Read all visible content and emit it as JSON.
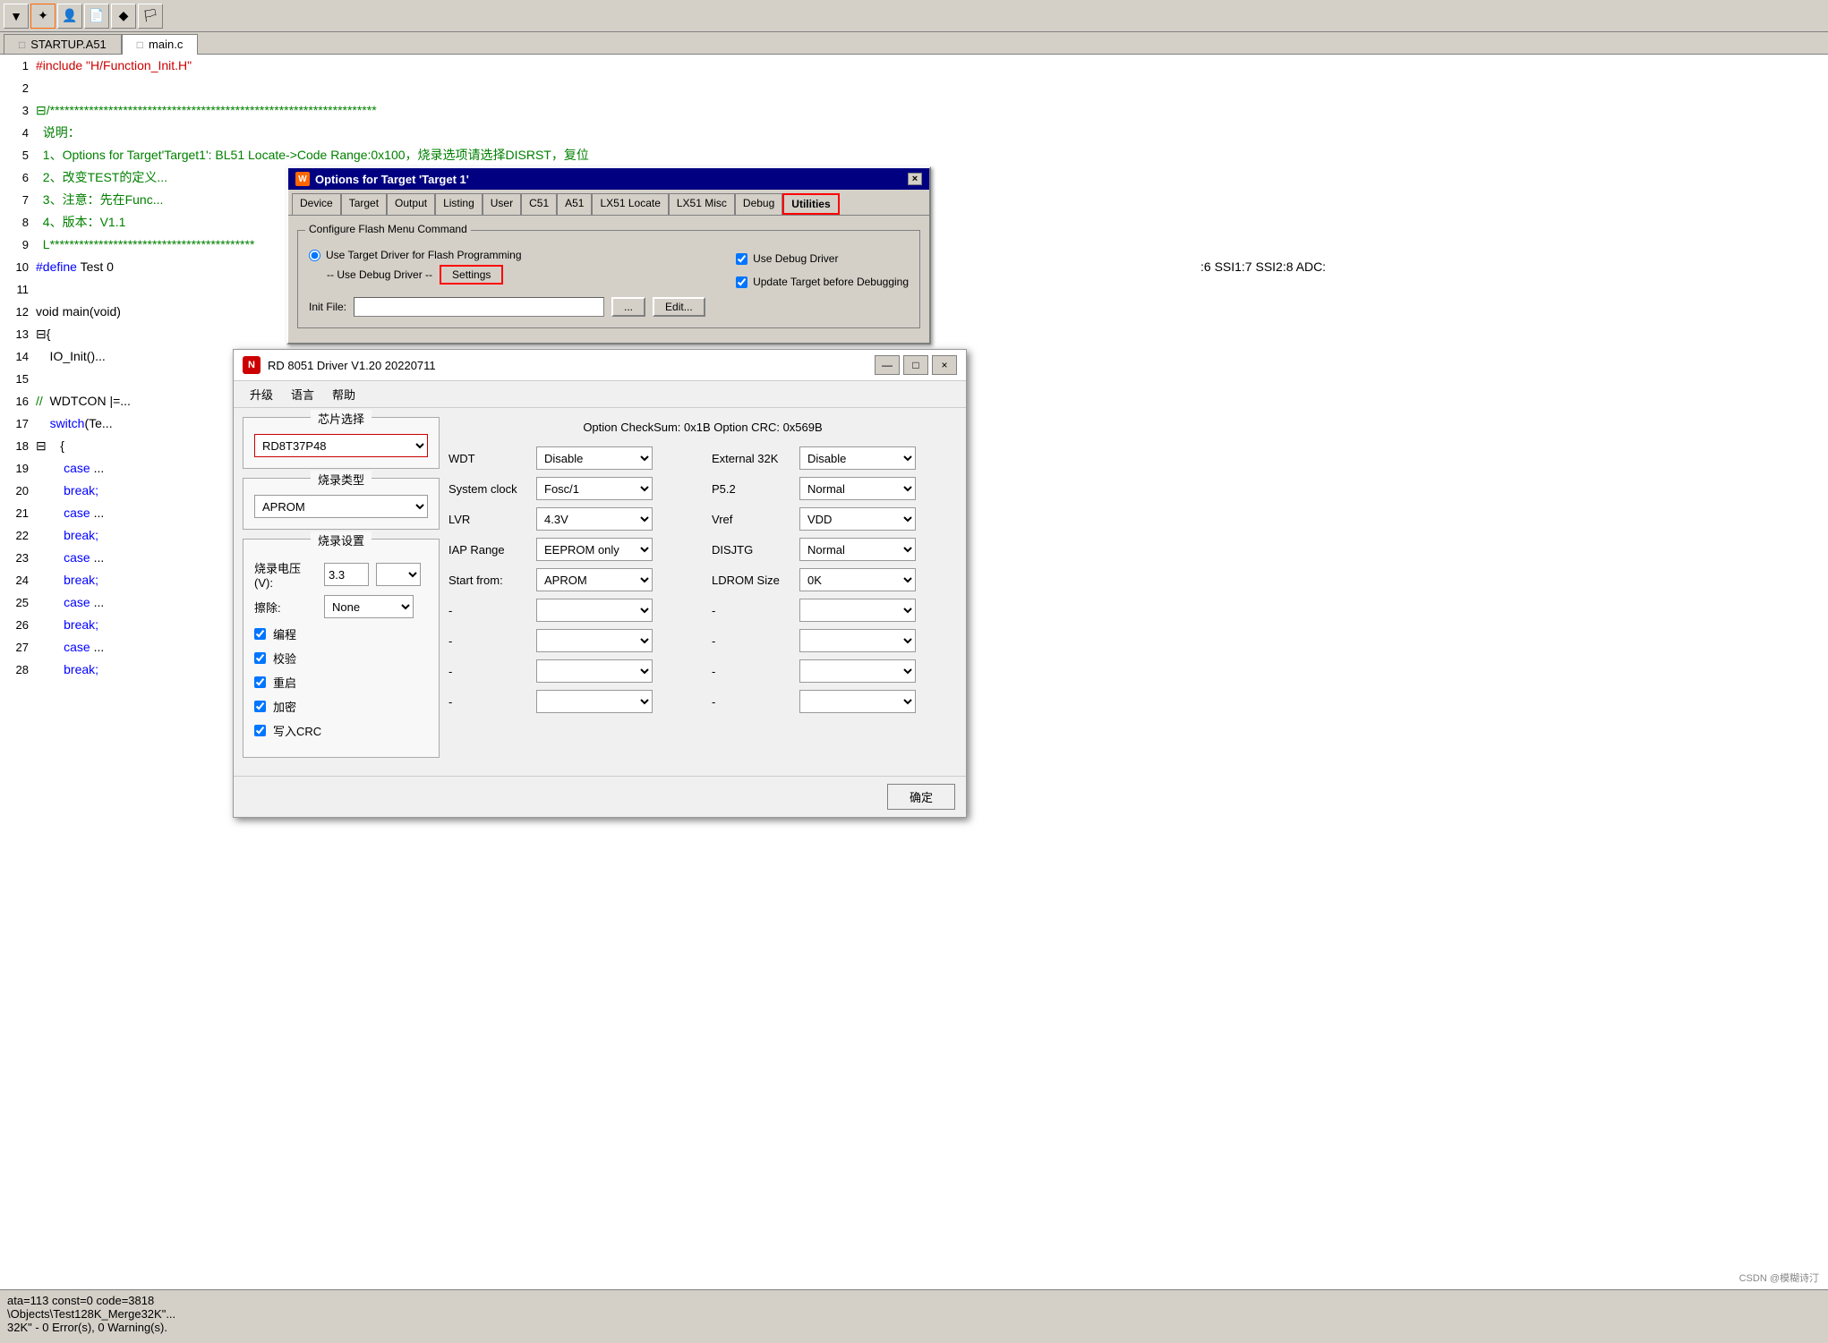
{
  "editor": {
    "toolbar_buttons": [
      "▼",
      "⚙",
      "👤",
      "📄",
      "◆",
      "🏳"
    ],
    "tabs": [
      {
        "label": "STARTUP.A51",
        "icon": "📄",
        "active": false
      },
      {
        "label": "main.c",
        "icon": "📄",
        "active": true
      }
    ],
    "lines": [
      {
        "num": "1",
        "content": "#include \"H/Function_Init.H\"",
        "class": "kw-red"
      },
      {
        "num": "2",
        "content": "",
        "class": "text-black"
      },
      {
        "num": "3",
        "content": "/*******************************************************************",
        "class": "comment-green",
        "prefix": "⊟"
      },
      {
        "num": "4",
        "content": "说明：",
        "class": "comment-green"
      },
      {
        "num": "5",
        "content": "1、Options for Target'Target1': BL51 Locate->Code Range:0x100，烧录选项请选择DISRST，复位",
        "class": "comment-green"
      },
      {
        "num": "6",
        "content": "2、改变TEST的定义...",
        "class": "comment-green"
      },
      {
        "num": "7",
        "content": "3、注意：先在Func...",
        "class": "comment-green"
      },
      {
        "num": "8",
        "content": "4、版本：V1.1",
        "class": "comment-green"
      },
      {
        "num": "9",
        "content": "L******************************************",
        "class": "comment-green",
        "prefix": "⊟"
      },
      {
        "num": "10",
        "content": "#define Test 0",
        "class": "kw-blue",
        "extra": ":6 SSI1:7 SSI2:8 ADC:"
      },
      {
        "num": "11",
        "content": "",
        "class": "text-black"
      },
      {
        "num": "12",
        "content": "void main(void)",
        "class": "text-black"
      },
      {
        "num": "13",
        "content": "{",
        "class": "text-black",
        "prefix": "⊟"
      },
      {
        "num": "14",
        "content": "    IO_Init()...",
        "class": "text-black"
      },
      {
        "num": "15",
        "content": "",
        "class": "text-black"
      },
      {
        "num": "16",
        "content": "// WDTCON |=...",
        "class": "text-black"
      },
      {
        "num": "17",
        "content": "    switch(Te...",
        "class": "kw-blue"
      },
      {
        "num": "18",
        "content": "    {",
        "class": "text-black",
        "prefix": "⊟"
      },
      {
        "num": "19",
        "content": "        case ...",
        "class": "kw-blue"
      },
      {
        "num": "20",
        "content": "        break;",
        "class": "kw-blue"
      },
      {
        "num": "21",
        "content": "        case ...",
        "class": "kw-blue"
      },
      {
        "num": "22",
        "content": "        break;",
        "class": "kw-blue"
      },
      {
        "num": "23",
        "content": "        case ...",
        "class": "kw-blue"
      },
      {
        "num": "24",
        "content": "        break;",
        "class": "kw-blue"
      },
      {
        "num": "25",
        "content": "        case ...",
        "class": "kw-blue"
      },
      {
        "num": "26",
        "content": "        break;",
        "class": "kw-blue"
      },
      {
        "num": "27",
        "content": "        case ...",
        "class": "kw-blue"
      },
      {
        "num": "28",
        "content": "        break;",
        "class": "kw-blue"
      }
    ]
  },
  "status_bar": {
    "line1": "ata=113 const=0 code=3818",
    "line2": "\\Objects\\Test128K_Merge32K\"...",
    "line3": "32K\" - 0 Error(s), 0 Warning(s)."
  },
  "options_dialog": {
    "title": "Options for Target 'Target 1'",
    "tabs": [
      {
        "label": "Device",
        "active": false
      },
      {
        "label": "Target",
        "active": false
      },
      {
        "label": "Output",
        "active": false
      },
      {
        "label": "Listing",
        "active": false
      },
      {
        "label": "User",
        "active": false
      },
      {
        "label": "C51",
        "active": false
      },
      {
        "label": "A51",
        "active": false
      },
      {
        "label": "LX51 Locate",
        "active": false
      },
      {
        "label": "LX51 Misc",
        "active": false
      },
      {
        "label": "Debug",
        "active": false
      },
      {
        "label": "Utilities",
        "active": true
      }
    ],
    "group_title": "Configure Flash Menu Command",
    "radio1": "Use Target Driver for Flash Programming",
    "radio1_checked": true,
    "checkbox1": "Use Debug Driver",
    "checkbox1_checked": true,
    "debug_driver_text": "-- Use Debug Driver --",
    "settings_btn": "Settings",
    "checkbox2": "Update Target before Debugging",
    "checkbox2_checked": true,
    "init_file_label": "Init File:",
    "init_file_value": "",
    "browse_btn": "...",
    "edit_btn": "Edit..."
  },
  "rd_dialog": {
    "title": "RD 8051 Driver V1.20 20220711",
    "logo": "N",
    "menu": [
      "升级",
      "语言",
      "帮助"
    ],
    "minimize": "—",
    "restore": "□",
    "close": "×",
    "chip_section": "芯片选择",
    "chip_value": "RD8T37P48",
    "burn_type_section": "烧录类型",
    "burn_type_value": "APROM",
    "burn_settings_section": "烧录设置",
    "voltage_label": "烧录电压(V):",
    "voltage_value": "3.3",
    "erase_label": "擦除:",
    "erase_value": "None",
    "cb_program": "编程",
    "cb_verify": "校验",
    "cb_reset": "重启",
    "cb_encrypt": "加密",
    "cb_write_crc": "写入CRC",
    "option_header": "Option CheckSum:  0x1B  Option CRC:  0x569B",
    "wdt_label": "WDT",
    "wdt_value": "Disable",
    "ext32k_label": "External 32K",
    "ext32k_value": "Disable",
    "sysclk_label": "System clock",
    "sysclk_value": "Fosc/1",
    "p52_label": "P5.2",
    "p52_value": "Normal",
    "lvr_label": "LVR",
    "lvr_value": "4.3V",
    "vref_label": "Vref",
    "vref_value": "VDD",
    "iap_label": "IAP Range",
    "iap_value": "EEPROM only",
    "disjtg_label": "DISJTG",
    "disjtg_value": "Normal",
    "start_label": "Start from:",
    "start_value": "APROM",
    "ldrom_label": "LDROM Size",
    "ldrom_value": "0K",
    "ok_btn": "确定"
  }
}
